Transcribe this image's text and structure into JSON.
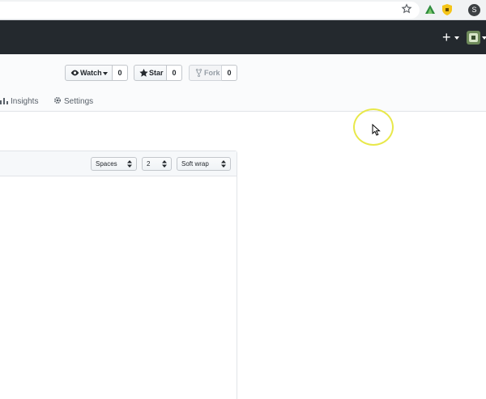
{
  "browser": {
    "profile_initial": "S"
  },
  "header": {
    "plus_label": "+"
  },
  "repo_actions": {
    "watch": {
      "label": "Watch",
      "count": "0"
    },
    "star": {
      "label": "Star",
      "count": "0"
    },
    "fork": {
      "label": "Fork",
      "count": "0"
    }
  },
  "tabs": [
    {
      "label": "Insights",
      "icon": "graph-icon"
    },
    {
      "label": "Settings",
      "icon": "gear-icon"
    }
  ],
  "editor": {
    "indent_mode": "Spaces",
    "indent_size": "2",
    "wrap_mode": "Soft wrap"
  },
  "colors": {
    "header_bg": "#24292e",
    "cursor_highlight": "#e8e84a"
  }
}
